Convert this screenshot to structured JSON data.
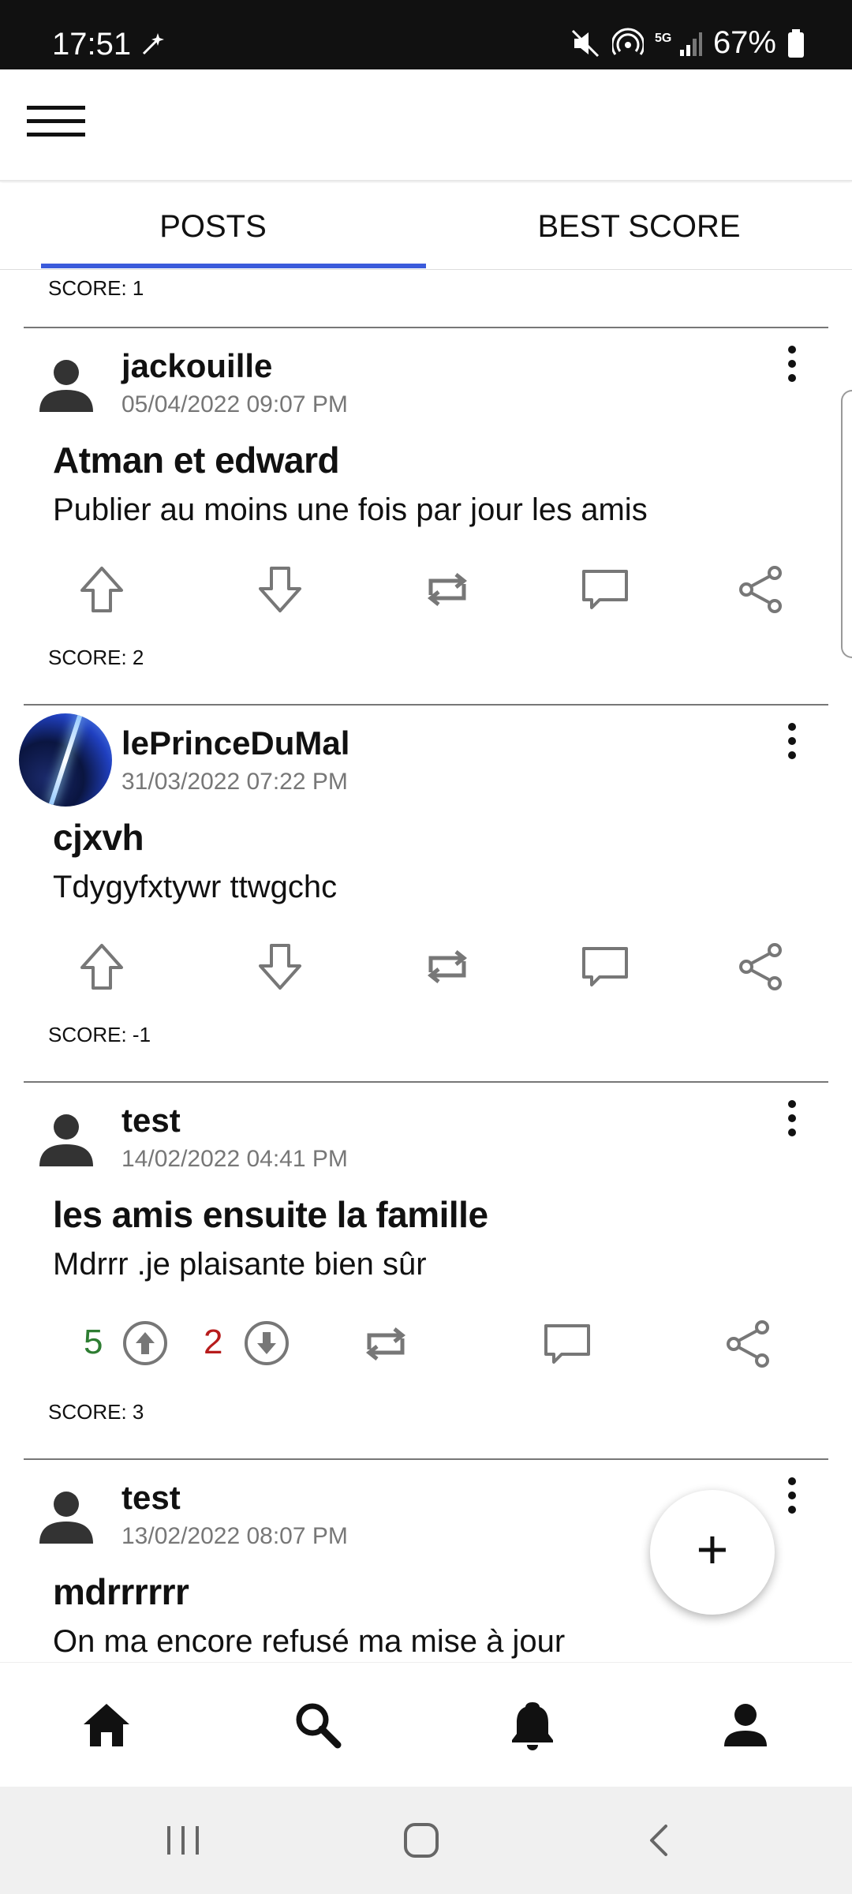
{
  "status_bar": {
    "time": "17:51",
    "battery": "67%"
  },
  "tabs": [
    {
      "label": "POSTS"
    },
    {
      "label": "BEST SCORE"
    }
  ],
  "top_score": "SCORE: 1",
  "posts": [
    {
      "username": "jackouille",
      "date": "05/04/2022 09:07 PM",
      "title": "Atman et edward",
      "body": "Publier au moins une fois par jour les amis",
      "score": "SCORE: 2"
    },
    {
      "username": "lePrinceDuMal",
      "date": "31/03/2022 07:22 PM",
      "title": "cjxvh",
      "body": "Tdygyfxtywr ttwgchc",
      "score": "SCORE: -1"
    },
    {
      "username": "test",
      "date": "14/02/2022 04:41 PM",
      "title": "les amis ensuite la famille",
      "body": "Mdrrr  .je plaisante bien sûr",
      "upvotes": "5",
      "downvotes": "2",
      "score": "SCORE: 3"
    },
    {
      "username": "test",
      "date": "13/02/2022 08:07 PM",
      "title": "mdrrrrrr",
      "body": "On ma encore refusé ma mise à jour"
    }
  ],
  "fab": {
    "label": "+"
  },
  "icons": {
    "menu": "hamburger-icon",
    "upvote": "arrow-up-icon",
    "downvote": "arrow-down-icon",
    "repost": "repost-icon",
    "comment": "comment-icon",
    "share": "share-icon",
    "home": "home-icon",
    "search": "search-icon",
    "notifications": "bell-icon",
    "profile": "person-icon"
  },
  "colors": {
    "tab_indicator": "#3b5bdb",
    "upvote_count": "#2e7d32",
    "downvote_count": "#b71c1c"
  }
}
